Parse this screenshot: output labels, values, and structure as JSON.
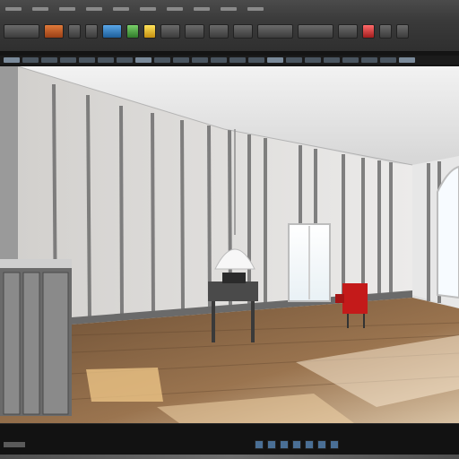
{
  "window": {
    "title": ""
  },
  "toolbar": {
    "menu_count": 10,
    "tools": [
      {
        "name": "select-tool-icon",
        "kind": "wide"
      },
      {
        "name": "move-tool-icon",
        "kind": "mid",
        "color": "orange"
      },
      {
        "name": "rotate-tool-icon",
        "kind": "sm"
      },
      {
        "name": "scale-tool-icon",
        "kind": "sm"
      },
      {
        "name": "render-tool-icon",
        "kind": "mid",
        "color": "blue"
      },
      {
        "name": "material-tool-icon",
        "kind": "sm",
        "color": "green"
      },
      {
        "name": "light-tool-icon",
        "kind": "sm",
        "color": "yellow"
      },
      {
        "name": "camera-tool-icon",
        "kind": "mid"
      },
      {
        "name": "snap-tool-icon",
        "kind": "mid"
      },
      {
        "name": "grid-tool-icon",
        "kind": "mid"
      },
      {
        "name": "layer-tool-icon",
        "kind": "mid"
      },
      {
        "name": "options-tool-icon",
        "kind": "wide"
      },
      {
        "name": "viewport-tool-icon",
        "kind": "wide"
      },
      {
        "name": "display-tool-icon",
        "kind": "mid"
      },
      {
        "name": "record-tool-icon",
        "kind": "sm",
        "color": "red"
      },
      {
        "name": "settings-tool-icon",
        "kind": "sm"
      },
      {
        "name": "help-tool-icon",
        "kind": "sm"
      }
    ]
  },
  "viewport": {
    "scene": "3d-room-render",
    "colors": {
      "wall": "#d9d6d2",
      "wall_stripe": "#6e6e6e",
      "floor": "#8a6a4a",
      "ceiling": "#e6e6e6",
      "chair": "#c41a1a",
      "desk": "#4a4a4a"
    }
  },
  "bottom": {
    "nav_buttons": 7
  }
}
